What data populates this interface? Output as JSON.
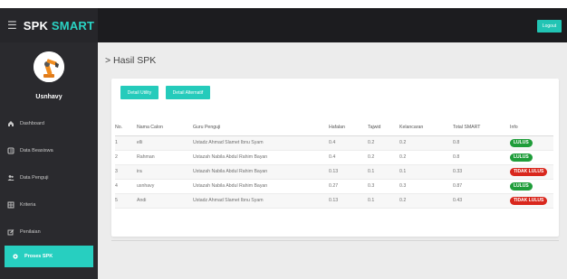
{
  "app": {
    "brand_main": "SPK",
    "brand_accent": "SMART",
    "logout_label": "Logout"
  },
  "user": {
    "name": "Usnhavy"
  },
  "sidebar": {
    "items": [
      {
        "label": "Dashboard",
        "icon": "home-icon"
      },
      {
        "label": "Data Beasiswa",
        "icon": "book-icon"
      },
      {
        "label": "Data Penguji",
        "icon": "users-icon"
      },
      {
        "label": "Kriteria",
        "icon": "grid-icon"
      },
      {
        "label": "Penilaian",
        "icon": "edit-icon"
      },
      {
        "label": "Proses SPK",
        "icon": "gear-icon"
      }
    ],
    "active_index": 5
  },
  "page": {
    "title": "> Hasil SPK"
  },
  "buttons": {
    "detail_utility": "Detail Utility",
    "detail_alternatif": "Detail Alternatif"
  },
  "table": {
    "headers": [
      "No.",
      "Nama Calon",
      "Guru Penguji",
      "Hafalan",
      "Tajwid",
      "Kelancaran",
      "Total SMART",
      "Info"
    ],
    "rows": [
      {
        "no": "1",
        "nama": "elli",
        "guru": "Ustadz Ahmad Slamet Ibnu Syam",
        "hafalan": "0.4",
        "tajwid": "0.2",
        "kelancaran": "0.2",
        "total": "0.8",
        "info": "LULUS",
        "status": "lulus"
      },
      {
        "no": "2",
        "nama": "Rahman",
        "guru": "Ustazah Nabila Abdul Rahim Bayan",
        "hafalan": "0.4",
        "tajwid": "0.2",
        "kelancaran": "0.2",
        "total": "0.8",
        "info": "LULUS",
        "status": "lulus"
      },
      {
        "no": "3",
        "nama": "ira",
        "guru": "Ustazah Nabila Abdul Rahim Bayan",
        "hafalan": "0.13",
        "tajwid": "0.1",
        "kelancaran": "0.1",
        "total": "0.33",
        "info": "TIDAK LULUS",
        "status": "tidak"
      },
      {
        "no": "4",
        "nama": "usnhavy",
        "guru": "Ustazah Nabila Abdul Rahim Bayan",
        "hafalan": "0.27",
        "tajwid": "0.3",
        "kelancaran": "0.3",
        "total": "0.87",
        "info": "LULUS",
        "status": "lulus"
      },
      {
        "no": "5",
        "nama": "Andi",
        "guru": "Ustadz Ahmad Slamet Ibnu Syam",
        "hafalan": "0.13",
        "tajwid": "0.1",
        "kelancaran": "0.2",
        "total": "0.43",
        "info": "TIDAK LULUS",
        "status": "tidak"
      }
    ]
  },
  "colors": {
    "accent": "#27cfc0",
    "pass": "#1f9d3a",
    "fail": "#d9271d",
    "topbar": "#1c1c1f",
    "sidebar": "#2a2a2e"
  }
}
